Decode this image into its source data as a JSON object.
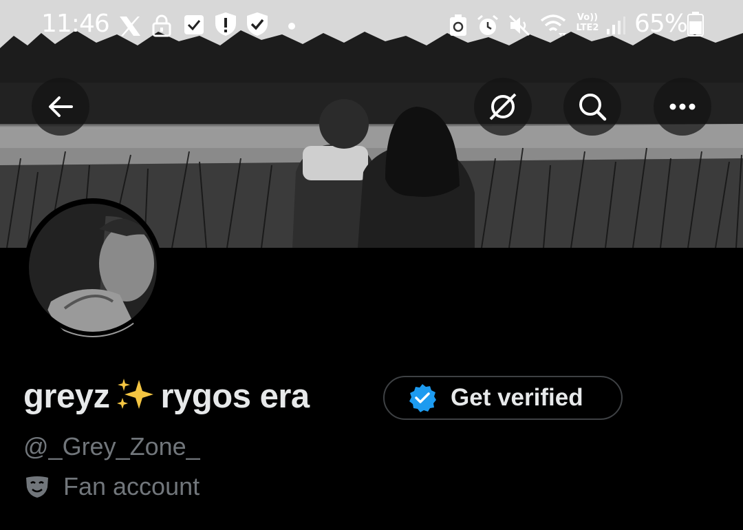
{
  "status_bar": {
    "time": "11:46",
    "battery_percent": "65%",
    "network_label": "Vo)) LTE2"
  },
  "nav": {
    "back_icon": "arrow-left-icon",
    "grok_icon": "grok-icon",
    "search_icon": "search-icon",
    "more_icon": "more-horizontal-icon"
  },
  "profile": {
    "name_part1": "greyz",
    "name_emoji": "sparkles-icon",
    "name_part2": "rygos era",
    "get_verified_label": "Get verified",
    "handle": "@_Grey_Zone_",
    "category": "Fan account",
    "category_icon": "theater-masks-icon"
  },
  "colors": {
    "background": "#000000",
    "name_text": "#e7e9ea",
    "secondary_text": "#71767b",
    "verified_blue": "#1d9bf0",
    "button_border": "#3e4144"
  }
}
